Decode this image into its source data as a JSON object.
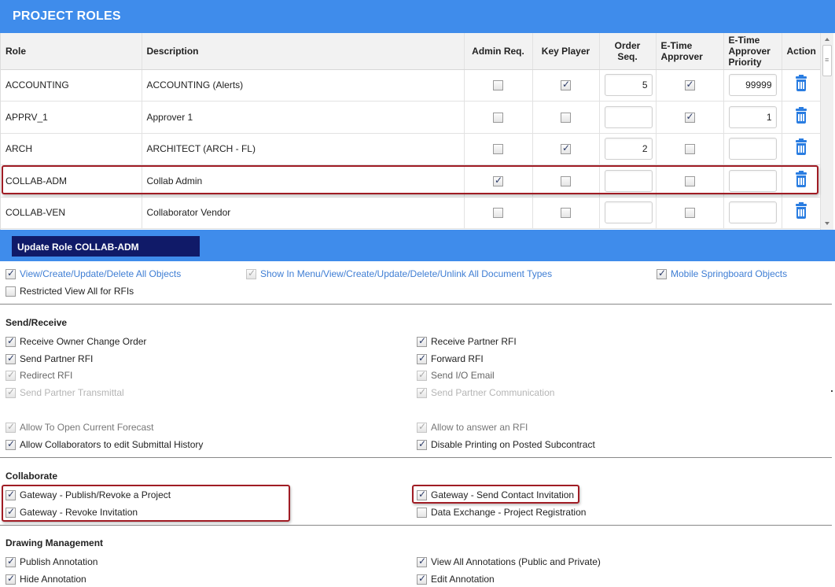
{
  "header": {
    "title": "PROJECT ROLES"
  },
  "roles_table": {
    "columns": [
      "Role",
      "Description",
      "Admin Req.",
      "Key Player",
      "Order Seq.",
      "E-Time Approver",
      "E-Time Approver Priority",
      "Action"
    ],
    "rows": [
      {
        "role": "ACCOUNTING",
        "description": "ACCOUNTING (Alerts)",
        "admin_req": false,
        "key_player": true,
        "order_seq": "5",
        "etime_approver": true,
        "etime_priority": "99999"
      },
      {
        "role": "APPRV_1",
        "description": "Approver 1",
        "admin_req": false,
        "key_player": false,
        "order_seq": "",
        "etime_approver": true,
        "etime_priority": "1"
      },
      {
        "role": "ARCH",
        "description": "ARCHITECT (ARCH - FL)",
        "admin_req": false,
        "key_player": true,
        "order_seq": "2",
        "etime_approver": false,
        "etime_priority": ""
      },
      {
        "role": "COLLAB-ADM",
        "description": "Collab Admin",
        "admin_req": true,
        "key_player": false,
        "order_seq": "",
        "etime_approver": false,
        "etime_priority": ""
      },
      {
        "role": "COLLAB-VEN",
        "description": "Collaborator Vendor",
        "admin_req": false,
        "key_player": false,
        "order_seq": "",
        "etime_approver": false,
        "etime_priority": ""
      }
    ]
  },
  "update_panel": {
    "title": "Update Role COLLAB-ADM",
    "general": {
      "view_all_objects": "View/Create/Update/Delete All Objects",
      "show_in_menu": "Show In Menu/View/Create/Update/Delete/Unlink All Document Types",
      "mobile_springboard": "Mobile Springboard Objects",
      "restricted_view": "Restricted View All for RFIs"
    },
    "send_receive": {
      "title": "Send/Receive",
      "receive_owner_co": "Receive Owner Change Order",
      "receive_partner_rfi": "Receive Partner RFI",
      "send_partner_rfi": "Send Partner RFI",
      "forward_rfi": "Forward RFI",
      "redirect_rfi": "Redirect RFI",
      "send_io_email": "Send I/O Email",
      "send_partner_transmittal": "Send Partner Transmittal",
      "send_partner_communication": "Send Partner Communication",
      "allow_open_forecast": "Allow To Open Current Forecast",
      "allow_answer_rfi": "Allow to answer an RFI",
      "allow_collab_edit": "Allow Collaborators to edit Submittal History",
      "disable_printing": "Disable Printing on Posted Subcontract"
    },
    "collaborate": {
      "title": "Collaborate",
      "gateway_publish": "Gateway - Publish/Revoke a Project",
      "gateway_send_invite": "Gateway - Send Contact Invitation",
      "gateway_revoke_invite": "Gateway - Revoke Invitation",
      "data_exchange": "Data Exchange - Project Registration"
    },
    "drawing": {
      "title": "Drawing Management",
      "publish_annotation": "Publish Annotation",
      "view_all_annotations": "View All Annotations (Public and Private)",
      "hide_annotation": "Hide Annotation",
      "edit_annotation": "Edit Annotation"
    }
  },
  "colors": {
    "header_blue": "#3f8ceb",
    "title_navy": "#101a68",
    "highlight_red": "#a01c24",
    "icon_blue": "#2a7de1",
    "link_blue": "#3f7ed4"
  }
}
